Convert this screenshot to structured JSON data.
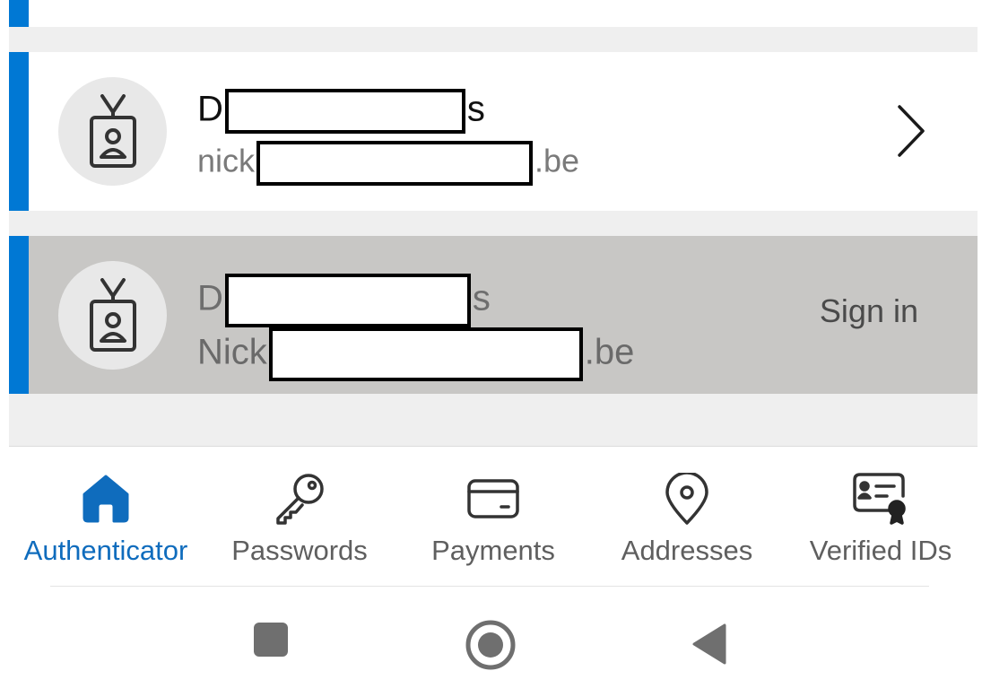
{
  "accounts": [
    {
      "name_start": "D",
      "name_end": "s",
      "email_start": "nick",
      "email_end": ".be",
      "action_icon": "chevron-right-icon",
      "selected": false
    },
    {
      "name_start": "D",
      "name_end": "s",
      "email_start": "Nick",
      "email_end": ".be",
      "action_label": "Sign in",
      "selected": true
    }
  ],
  "account_icon": "work-badge-icon",
  "tabs": [
    {
      "label": "Authenticator",
      "icon": "home-icon",
      "active": true
    },
    {
      "label": "Passwords",
      "icon": "key-icon",
      "active": false
    },
    {
      "label": "Payments",
      "icon": "credit-card-icon",
      "active": false
    },
    {
      "label": "Addresses",
      "icon": "location-pin-icon",
      "active": false
    },
    {
      "label": "Verified IDs",
      "icon": "verified-id-icon",
      "active": false
    }
  ],
  "system_nav": [
    "recents-square-icon",
    "home-circle-icon",
    "back-triangle-icon"
  ],
  "colors": {
    "accent": "#0078d4",
    "active_tab": "#0f6cbd",
    "selected_row": "#c8c7c5",
    "list_background": "#efefef"
  }
}
